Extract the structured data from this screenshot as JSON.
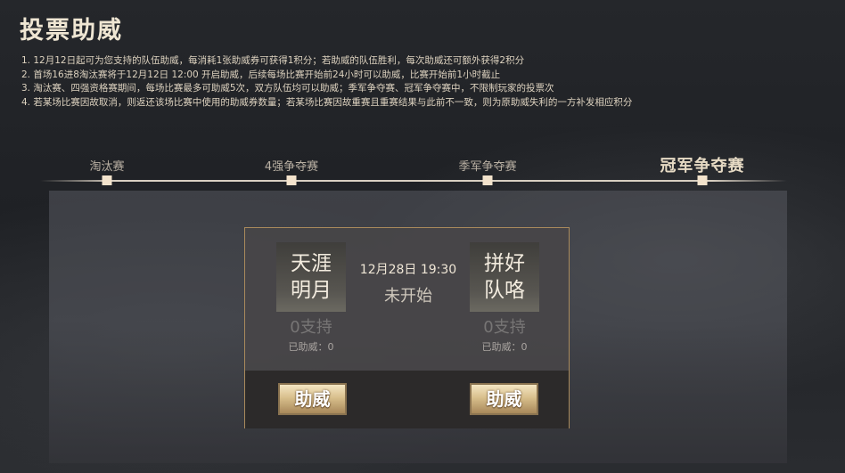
{
  "page": {
    "title": "投票助威"
  },
  "rules": [
    "1. 12月12日起可为您支持的队伍助威，每消耗1张助威券可获得1积分；若助威的队伍胜利，每次助威还可额外获得2积分",
    "2. 首场16进8淘汰赛将于12月12日 12:00 开启助威，后续每场比赛开始前24小时可以助威，比赛开始前1小时截止",
    "3. 淘汰赛、四强资格赛期间，每场比赛最多可助威5次，双方队伍均可以助威；季军争夺赛、冠军争夺赛中，不限制玩家的投票次",
    "4. 若某场比赛因故取消，则返还该场比赛中使用的助威券数量；若某场比赛因故重赛且重赛结果与此前不一致，则为原助威失利的一方补发相应积分"
  ],
  "stages": [
    {
      "label": "淘汰赛",
      "active": false
    },
    {
      "label": "4强争夺赛",
      "active": false
    },
    {
      "label": "季军争夺赛",
      "active": false
    },
    {
      "label": "冠军争夺赛",
      "active": true
    }
  ],
  "match": {
    "time": "12月28日 19:30",
    "status": "未开始",
    "team_left": {
      "name": "天涯明月",
      "support": "0支持",
      "helped": "已助威：0",
      "button": "助威"
    },
    "team_right": {
      "name": "拼好队咯",
      "support": "0支持",
      "helped": "已助威：0",
      "button": "助威"
    }
  },
  "colors": {
    "accent_gold": "#d8bf8c",
    "card_border": "#a98a5c",
    "dot": "#f3e3cc"
  }
}
